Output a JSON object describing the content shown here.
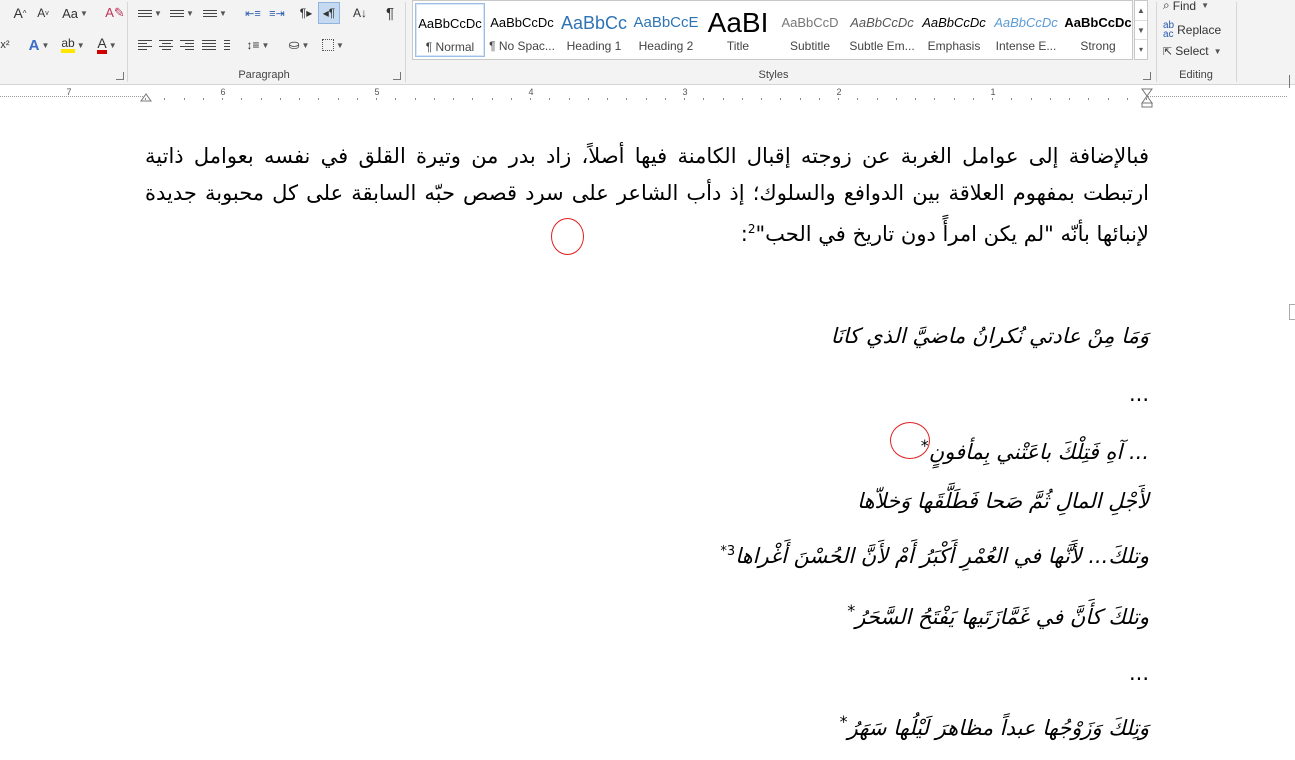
{
  "ribbon": {
    "font_row": {
      "grow_font": "A",
      "shrink_font": "A",
      "change_case": "Aa",
      "superscript": "x²"
    },
    "groups": {
      "paragraph": "Paragraph",
      "styles": "Styles",
      "editing": "Editing"
    },
    "styles": [
      {
        "sample": "AaBbCcDc",
        "name": "¶ Normal",
        "selected": true
      },
      {
        "sample": "AaBbCcDc",
        "name": "¶ No Spac..."
      },
      {
        "sample": "AaBbCc",
        "name": "Heading 1"
      },
      {
        "sample": "AaBbCcE",
        "name": "Heading 2"
      },
      {
        "sample": "AaBI",
        "name": "Title"
      },
      {
        "sample": "AaBbCcD",
        "name": "Subtitle"
      },
      {
        "sample": "AaBbCcDc",
        "name": "Subtle Em..."
      },
      {
        "sample": "AaBbCcDc",
        "name": "Emphasis"
      },
      {
        "sample": "AaBbCcDc",
        "name": "Intense E..."
      },
      {
        "sample": "AaBbCcDc",
        "name": "Strong"
      }
    ],
    "editing": {
      "find": "Find",
      "replace": "Replace",
      "select": "Select"
    }
  },
  "ruler": {
    "numbers": [
      "7",
      "6",
      "5",
      "4",
      "3",
      "2",
      "1"
    ]
  },
  "document": {
    "paragraph": "فبالإضافة إلى عوامل الغربة عن زوجته إقبال الكامنة فيها أصلاً، زاد بدر من وتيرة القلق في نفسه بعوامل ذاتية ارتبطت بمفهوم العلاقة بين الدوافع والسلوك؛ إذ دأب الشاعر على سرد قصص حبّه السابقة على كل محبوبة جديدة لإنبائها بأنّه \"لم يكن امرأً دون تاريخ في الحب\"",
    "paragraph_footnote": "2",
    "paragraph_end": ":",
    "verses": [
      {
        "text": "وَمَا مِنْ عادتي نُكرانُ ماضيَّ الذي كانَا"
      },
      {
        "text": "..."
      },
      {
        "text": "... آهِ فَتِلْكَ باعَتْني بِمأفونٍ",
        "marker": "*"
      },
      {
        "text": "لأَجْلِ المالِ ثُمَّ صَحا فَطَلَّقَها وَخلاّها"
      },
      {
        "text": "وتلكَ... لأَنَّها في العُمْرِ أَكْبَرُ أَمْ لأَنَّ الحُسْنَ أَغْراها",
        "marker": "3*"
      },
      {
        "text": "وتلكَ كأَنَّ في غَمَّازَتَيها يَفْتَحُ السَّحَرُ",
        "marker": "*"
      },
      {
        "text": "..."
      },
      {
        "text": "وَتِلكَ وَزَوْجُها عبداً مظاهرَ لَيْلُها سَهَرُ",
        "marker": "*"
      }
    ]
  },
  "colors": {
    "annotation_circle": "#e02020",
    "highlight_yellow": "#ffe600",
    "font_color_red": "#d00000"
  }
}
